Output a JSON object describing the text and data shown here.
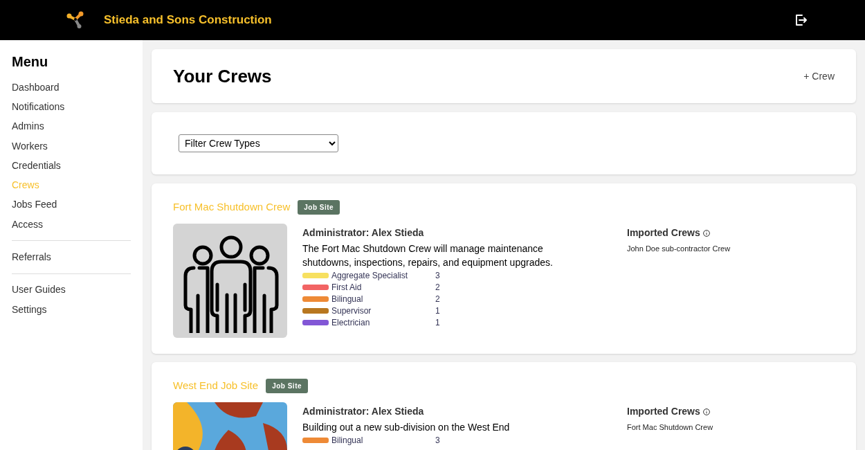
{
  "header": {
    "company": "Stieda and Sons Construction"
  },
  "sidebar": {
    "title": "Menu",
    "groups": [
      [
        {
          "label": "Dashboard",
          "selected": false
        },
        {
          "label": "Notifications",
          "selected": false
        },
        {
          "label": "Admins",
          "selected": false
        },
        {
          "label": "Workers",
          "selected": false
        },
        {
          "label": "Credentials",
          "selected": false
        },
        {
          "label": "Crews",
          "selected": true
        },
        {
          "label": "Jobs Feed",
          "selected": false
        },
        {
          "label": "Access",
          "selected": false
        }
      ],
      [
        {
          "label": "Referrals",
          "selected": false
        }
      ],
      [
        {
          "label": "User Guides",
          "selected": false
        },
        {
          "label": "Settings",
          "selected": false
        }
      ]
    ]
  },
  "page": {
    "title": "Your Crews",
    "add_button": "+ Crew"
  },
  "filter": {
    "value": "Filter Crew Types"
  },
  "crews": [
    {
      "name": "Fort Mac Shutdown Crew",
      "tag": "Job Site",
      "kind": "icon",
      "administrator": "Administrator: Alex Stieda",
      "description": "The Fort Mac Shutdown Crew will manage maintenance shutdowns, inspections, repairs, and equipment upgrades.",
      "skills": [
        {
          "label": "Aggregate Specialist",
          "count": "3",
          "color": "#f7e060"
        },
        {
          "label": "First Aid",
          "count": "2",
          "color": "#f26464"
        },
        {
          "label": "Bilingual",
          "count": "2",
          "color": "#ee8a36"
        },
        {
          "label": "Supervisor",
          "count": "1",
          "color": "#b87720"
        },
        {
          "label": "Electrician",
          "count": "1",
          "color": "#8257d6"
        }
      ],
      "imported_title": "Imported Crews",
      "imported": [
        "John Doe sub-contractor Crew"
      ]
    },
    {
      "name": "West End Job Site",
      "tag": "Job Site",
      "kind": "picture",
      "administrator": "Administrator: Alex Stieda",
      "description": "Building out a new sub-division on the West End",
      "skills": [
        {
          "label": "Bilingual",
          "count": "3",
          "color": "#ee8a36"
        }
      ],
      "imported_title": "Imported Crews",
      "imported": [
        "Fort Mac Shutdown Crew"
      ]
    }
  ]
}
